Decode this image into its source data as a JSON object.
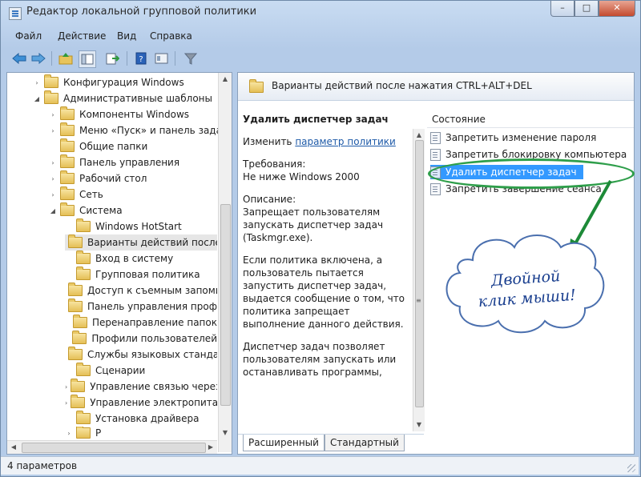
{
  "window": {
    "title": "Редактор локальной групповой политики",
    "buttons": {
      "minimize": "–",
      "maximize": "□",
      "close": "✕"
    }
  },
  "menu": [
    "Файл",
    "Действие",
    "Вид",
    "Справка"
  ],
  "toolbar": {
    "icons": [
      "back-arrow-icon",
      "forward-arrow-icon",
      "up-folder-icon",
      "show-hide-tree-icon",
      "export-list-icon",
      "help-icon",
      "properties-icon",
      "filter-icon"
    ]
  },
  "tree": {
    "items": [
      {
        "label": "Конфигурация Windows",
        "expander": "›"
      },
      {
        "label": "Административные шаблоны",
        "expander": "◢"
      },
      {
        "label": "Компоненты Windows",
        "expander": "›"
      },
      {
        "label": "Меню «Пуск» и панель задач",
        "expander": "›"
      },
      {
        "label": "Общие папки",
        "expander": ""
      },
      {
        "label": "Панель управления",
        "expander": "›"
      },
      {
        "label": "Рабочий стол",
        "expander": "›"
      },
      {
        "label": "Сеть",
        "expander": "›"
      },
      {
        "label": "Система",
        "expander": "◢"
      },
      {
        "label": "Windows HotStart",
        "expander": ""
      },
      {
        "label": "Варианты действий после нажатия",
        "expander": "",
        "selected": true
      },
      {
        "label": "Вход в систему",
        "expander": ""
      },
      {
        "label": "Групповая политика",
        "expander": ""
      },
      {
        "label": "Доступ к съемным запоминающим",
        "expander": ""
      },
      {
        "label": "Панель управления профилями",
        "expander": ""
      },
      {
        "label": "Перенаправление папок",
        "expander": ""
      },
      {
        "label": "Профили пользователей",
        "expander": ""
      },
      {
        "label": "Службы языковых стандартов",
        "expander": ""
      },
      {
        "label": "Сценарии",
        "expander": ""
      },
      {
        "label": "Управление связью через Интернет",
        "expander": "›"
      },
      {
        "label": "Управление электропитанием",
        "expander": "›"
      },
      {
        "label": "Установка драйвера",
        "expander": ""
      },
      {
        "label": "Р",
        "expander": "›"
      }
    ]
  },
  "right_pane": {
    "header": "Варианты действий после нажатия CTRL+ALT+DEL",
    "description": {
      "title": "Удалить диспетчер задач",
      "edit_prefix": "Изменить ",
      "edit_link": "параметр политики",
      "requirements_label": "Требования:",
      "requirements_value": "Не ниже Windows 2000",
      "description_label": "Описание:",
      "description_text": "Запрещает пользователям запускать диспетчер задач (Taskmgr.exe).",
      "paragraph2": "Если политика включена, а пользователь пытается запустить диспетчер задач, выдается сообщение о том, что политика запрещает выполнение данного действия.",
      "paragraph3": "Диспетчер задач позволяет пользователям запускать или останавливать программы, наблюдать за производительностью своих"
    },
    "column_header": "Состояние",
    "policies": [
      {
        "label": "Запретить изменение пароля",
        "selected": false
      },
      {
        "label": "Запретить блокировку компьютера",
        "selected": false
      },
      {
        "label": "Удалить диспетчер задач",
        "selected": true
      },
      {
        "label": "Запретить завершение сеанса",
        "selected": false
      }
    ],
    "tabs": [
      "Расширенный",
      "Стандартный"
    ]
  },
  "annotation": {
    "line1": "Двойной",
    "line2": "клик мыши!",
    "color": "#2e9e4a"
  },
  "status": "4 параметров"
}
